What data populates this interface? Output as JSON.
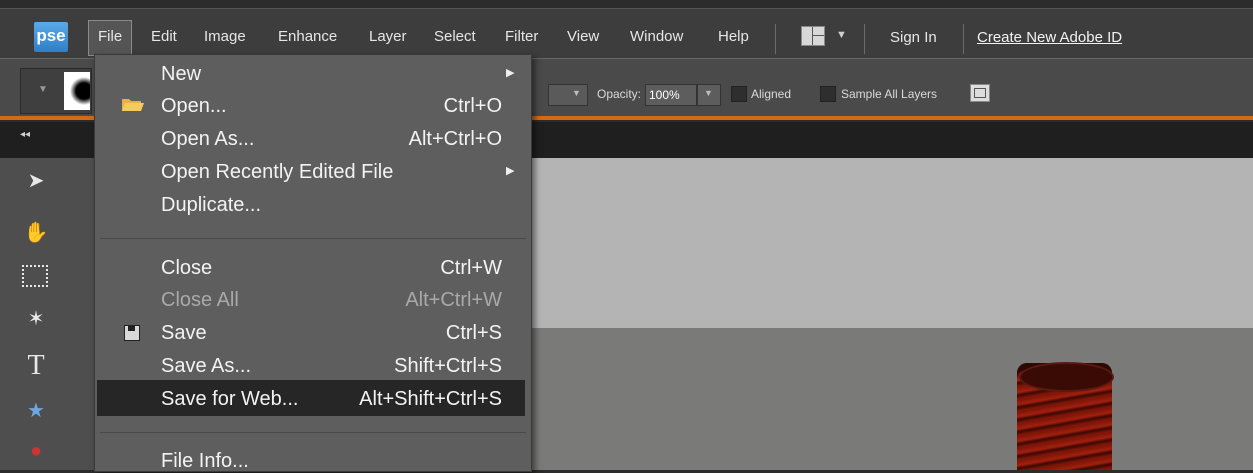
{
  "app": {
    "logo": "pse"
  },
  "menubar": {
    "items": [
      "File",
      "Edit",
      "Image",
      "Enhance",
      "Layer",
      "Select",
      "Filter",
      "View",
      "Window",
      "Help"
    ],
    "sign_in": "Sign In",
    "create_id": "Create New Adobe ID"
  },
  "options_bar": {
    "opacity_label": "Opacity:",
    "opacity_value": "100%",
    "aligned_label": "Aligned",
    "sample_label": "Sample All Layers"
  },
  "panel": {
    "collapse": "◂◂"
  },
  "file_menu": {
    "items": [
      {
        "label": "New",
        "shortcut": ""
      },
      {
        "label": "Open...",
        "shortcut": "Ctrl+O"
      },
      {
        "label": "Open As...",
        "shortcut": "Alt+Ctrl+O"
      },
      {
        "label": "Open Recently Edited File",
        "shortcut": ""
      },
      {
        "label": "Duplicate...",
        "shortcut": ""
      },
      {
        "label": "Close",
        "shortcut": "Ctrl+W"
      },
      {
        "label": "Close All",
        "shortcut": "Alt+Ctrl+W"
      },
      {
        "label": "Save",
        "shortcut": "Ctrl+S"
      },
      {
        "label": "Save As...",
        "shortcut": "Shift+Ctrl+S"
      },
      {
        "label": "Save for Web...",
        "shortcut": "Alt+Shift+Ctrl+S"
      },
      {
        "label": "File Info...",
        "shortcut": ""
      }
    ],
    "highlight_color": "#262626",
    "accent_color": "#d56a12"
  }
}
